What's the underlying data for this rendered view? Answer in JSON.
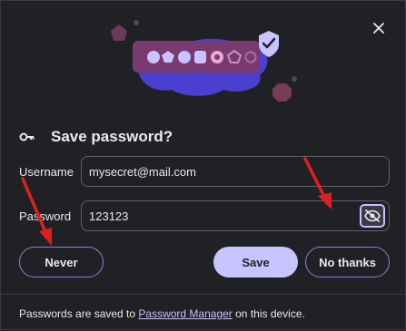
{
  "dialog": {
    "title": "Save password?",
    "username_label": "Username",
    "username_value": "mysecret@mail.com",
    "password_label": "Password",
    "password_value": "123123",
    "never_button": "Never",
    "save_button": "Save",
    "no_thanks_button": "No thanks",
    "footer_prefix": "Passwords are saved to ",
    "footer_link": "Password Manager",
    "footer_suffix": " on this device."
  },
  "colors": {
    "background": "#202124",
    "accent": "#c9c4ff",
    "button_outline": "#8a80e0",
    "annotation_arrow": "#e02020"
  },
  "icons": [
    "close-icon",
    "key-icon",
    "eye-off-icon",
    "shield-check-icon"
  ]
}
